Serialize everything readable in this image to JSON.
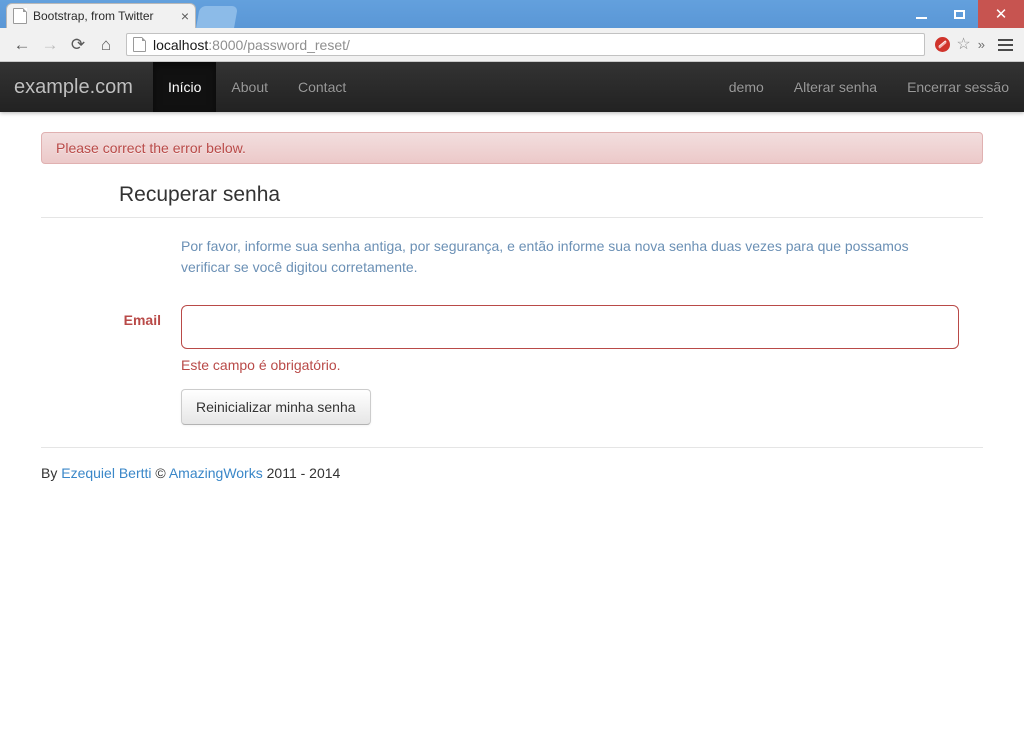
{
  "browser": {
    "tab": {
      "title": "Bootstrap, from Twitter",
      "close_label": "×",
      "favicon_name": "page-icon"
    },
    "window_controls": {
      "minimize_label": "",
      "maximize_label": "",
      "close_label": "✕"
    },
    "toolbar": {
      "back_label": "←",
      "forward_label": "→",
      "reload_label": "⟳",
      "home_label": "⌂",
      "url_host": "localhost",
      "url_rest": ":8000/password_reset/",
      "url_full": "localhost:8000/password_reset/",
      "star_label": "☆",
      "chevrons_label": "»",
      "menu_label": ""
    }
  },
  "navbar": {
    "brand": "example.com",
    "left_items": [
      {
        "label": "Início",
        "active": true
      },
      {
        "label": "About",
        "active": false
      },
      {
        "label": "Contact",
        "active": false
      }
    ],
    "right_items": [
      {
        "label": "demo"
      },
      {
        "label": "Alterar senha"
      },
      {
        "label": "Encerrar sessão"
      }
    ]
  },
  "alert": {
    "message": "Please correct the error below.",
    "color": "#b94a48",
    "background": "#f2dede"
  },
  "form": {
    "legend": "Recuperar senha",
    "help_text": "Por favor, informe sua senha antiga, por segurança, e então informe sua nova senha duas vezes para que possamos verificar se você digitou corretamente.",
    "field": {
      "label": "Email",
      "value": "",
      "placeholder": "",
      "error": "Este campo é obrigatório.",
      "error_color": "#b94a48"
    },
    "submit_label": "Reinicializar minha senha"
  },
  "footer": {
    "prefix": "By ",
    "author": "Ezequiel Bertti",
    "copyright_symbol": " © ",
    "company": "AmazingWorks",
    "years": " 2011 - 2014",
    "link_color": "#3a87c8"
  }
}
